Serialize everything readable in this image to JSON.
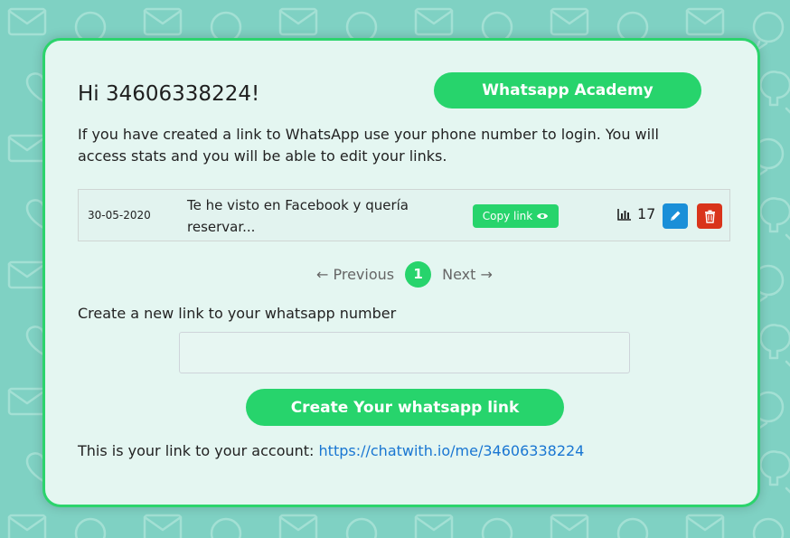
{
  "greeting": "Hi 34606338224!",
  "academy_button": "Whatsapp Academy",
  "intro": "If you have created a link to WhatsApp use your phone number to login. You will access stats and you will be able to edit your links.",
  "links": [
    {
      "date": "30-05-2020",
      "message": "Te he visto en Facebook y quería reservar...",
      "copy_label": "Copy link",
      "clicks": "17"
    }
  ],
  "pagination": {
    "previous": "← Previous",
    "current": "1",
    "next": "Next →"
  },
  "create": {
    "label": "Create a new link to your whatsapp number",
    "input_value": "",
    "button": "Create Your whatsapp link"
  },
  "account": {
    "text": "This is your link to your account:",
    "url": "https://chatwith.io/me/34606338224"
  },
  "colors": {
    "brand_green": "#27d46c",
    "card_bg": "#e4f6f1",
    "page_bg": "#7fd1c3",
    "edit_blue": "#1a8fd8",
    "delete_red": "#d9341b",
    "link_blue": "#1976d2"
  },
  "icons": [
    "eye-icon",
    "bar-chart-icon",
    "pencil-icon",
    "trash-icon",
    "envelope-icon",
    "chat-bubble-icon",
    "heart-icon",
    "lightbulb-icon"
  ]
}
